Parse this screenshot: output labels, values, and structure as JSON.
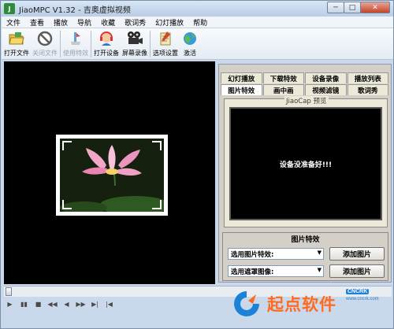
{
  "window": {
    "title": "JiaoMPC V1.32 - 吉奥虚拟视频",
    "app_icon": "J"
  },
  "titlebar_buttons": {
    "minimize": "─",
    "maximize": "□",
    "close": "✕"
  },
  "menu": [
    "文件",
    "查看",
    "播放",
    "导航",
    "收藏",
    "歌词秀",
    "幻灯播放",
    "帮助"
  ],
  "toolbar": {
    "open_file": "打开文件",
    "close_file": "关闭文件",
    "use_effects": "使用特效",
    "open_device": "打开设备",
    "screen_record": "屏幕录像",
    "options": "选项设置",
    "activate": "激活"
  },
  "tabs": {
    "row1": [
      "幻灯播放",
      "下载特效",
      "设备录像",
      "播放列表"
    ],
    "row2": [
      "图片特效",
      "画中画",
      "视频滤镜",
      "歌词秀"
    ],
    "active": "图片特效"
  },
  "preview": {
    "caption": "JiaoCap 预览",
    "message": "设备没准备好!!!"
  },
  "effects": {
    "title": "图片特效",
    "select1": "选用图片特效:",
    "button1": "添加图片",
    "select2": "选用遮罩图像:",
    "button2": "添加图片"
  },
  "controls": [
    "▶",
    "▮▮",
    "■",
    "◀◀",
    "◀",
    "▶▶",
    "▶|",
    "|◀"
  ],
  "watermark": {
    "text": "起点软件",
    "badge": "CNCRK",
    "url": "www.cncrk.com"
  },
  "colors": {
    "accent_orange": "#ff6a1e",
    "accent_blue": "#1c82d8",
    "video_bg": "#000000"
  }
}
